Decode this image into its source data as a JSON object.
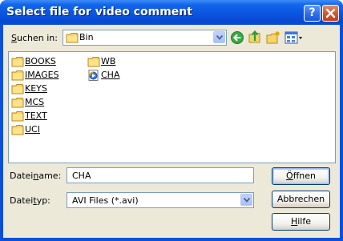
{
  "window": {
    "title": "Select file for video comment",
    "help_icon": "question-mark-icon",
    "close_icon": "close-x-icon"
  },
  "look_in": {
    "label_prefix": "S",
    "label_rest": "uchen in:",
    "value": "Bin",
    "folder_icon": "folder-icon"
  },
  "toolbar": {
    "back_icon": "back-arrow-icon",
    "up_icon": "up-folder-icon",
    "new_folder_icon": "new-folder-icon",
    "views_icon": "view-menu-icon"
  },
  "files": [
    {
      "name": "BOOKS",
      "icon": "folder-icon"
    },
    {
      "name": "IMAGES",
      "icon": "folder-icon"
    },
    {
      "name": "KEYS",
      "icon": "folder-icon"
    },
    {
      "name": "MCS",
      "icon": "folder-icon"
    },
    {
      "name": "TEXT",
      "icon": "folder-icon"
    },
    {
      "name": "UCI",
      "icon": "folder-icon"
    },
    {
      "name": "WB",
      "icon": "folder-icon"
    },
    {
      "name": "CHA",
      "icon": "media-file-icon"
    }
  ],
  "filename": {
    "label_a": "Datei",
    "label_u": "n",
    "label_b": "ame:",
    "value": "CHA"
  },
  "filetype": {
    "label_a": "Datei",
    "label_u": "t",
    "label_b": "yp:",
    "value": "AVI Files (*.avi)"
  },
  "buttons": {
    "open_u": "Ö",
    "open_rest": "ffnen",
    "cancel": "Abbrechen",
    "help_u": "H",
    "help_rest": "ilfe"
  }
}
